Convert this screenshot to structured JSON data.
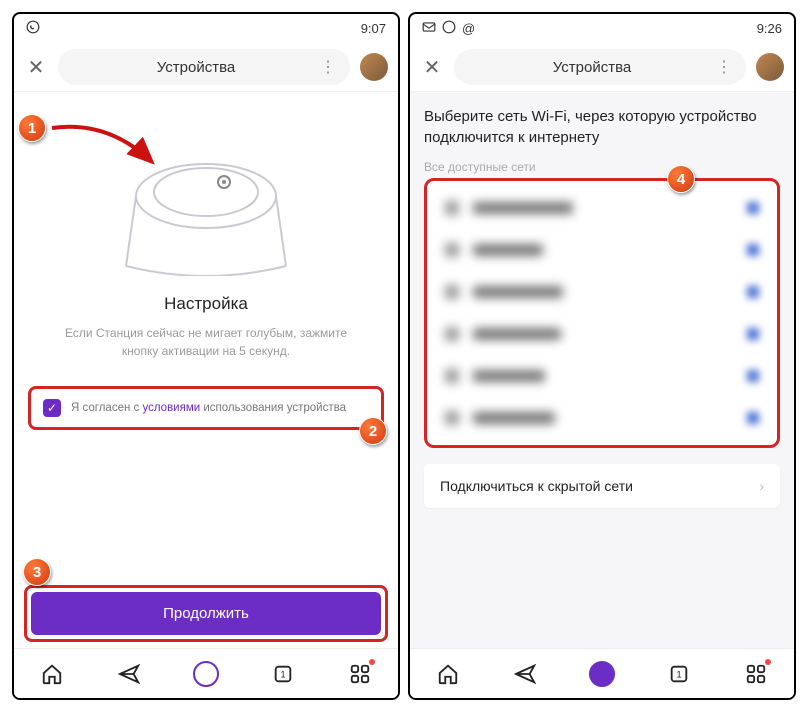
{
  "left": {
    "status": {
      "time": "9:07"
    },
    "header": {
      "title": "Устройства"
    },
    "setup": {
      "title": "Настройка",
      "subtitle": "Если Станция сейчас не мигает голубым, зажмите кнопку активации на 5 секунд."
    },
    "consent": {
      "pre": "Я согласен с ",
      "link": "условиями",
      "post": " использования устройства"
    },
    "continue_label": "Продолжить"
  },
  "right": {
    "status": {
      "time": "9:26"
    },
    "header": {
      "title": "Устройства"
    },
    "wifi": {
      "heading": "Выберите сеть Wi-Fi, через которую устройство подключится к интернету",
      "subheading": "Все доступные сети",
      "hidden_label": "Подключиться к скрытой сети",
      "items": [
        {
          "name_width": 100
        },
        {
          "name_width": 70
        },
        {
          "name_width": 90
        },
        {
          "name_width": 88
        },
        {
          "name_width": 72
        },
        {
          "name_width": 82
        }
      ]
    }
  },
  "callouts": {
    "c1": "1",
    "c2": "2",
    "c3": "3",
    "c4": "4"
  },
  "colors": {
    "accent": "#6c2dc7",
    "highlight_border": "#d62324"
  }
}
